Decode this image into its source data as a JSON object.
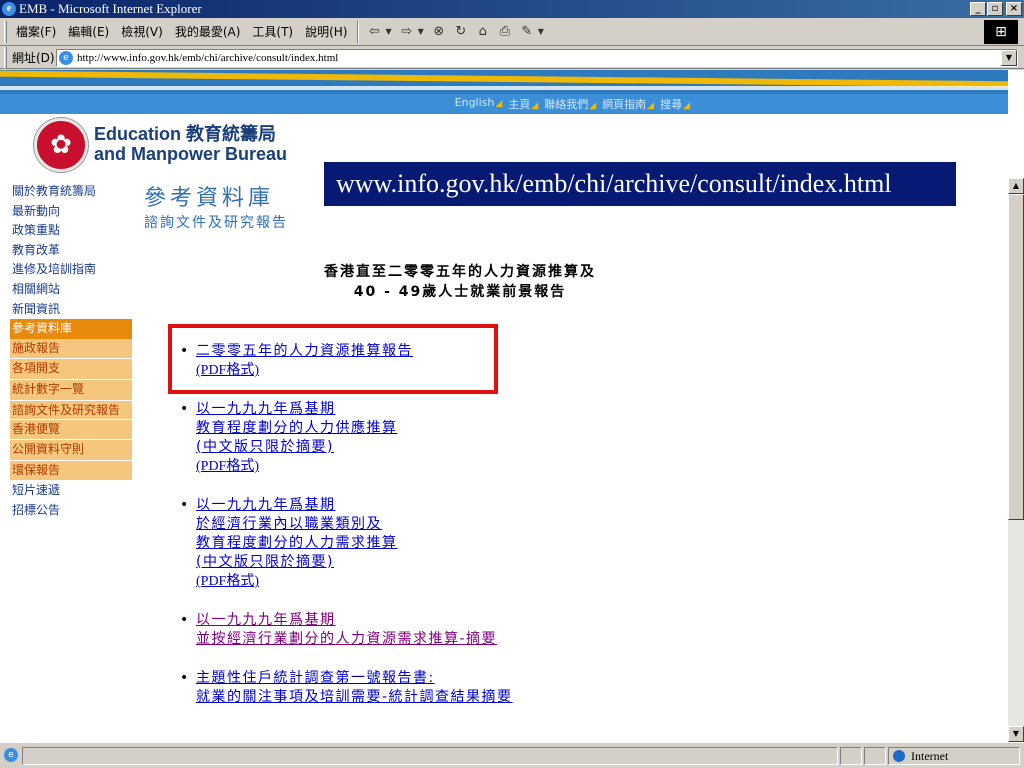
{
  "window": {
    "title": "EMB - Microsoft Internet Explorer"
  },
  "menu": {
    "items": [
      "檔案(F)",
      "編輯(E)",
      "檢視(V)",
      "我的最愛(A)",
      "工具(T)",
      "說明(H)"
    ]
  },
  "toolbar_icons": [
    "back-icon",
    "forward-icon",
    "stop-icon",
    "refresh-icon",
    "home-icon",
    "print-icon",
    "edit-icon"
  ],
  "address": {
    "label": "網址(D)",
    "url": "http://www.info.gov.hk/emb/chi/archive/consult/index.html"
  },
  "topnav": [
    "English",
    "主頁",
    "聯絡我們",
    "網頁指南",
    "搜尋"
  ],
  "org": {
    "line1": "Education 教育統籌局",
    "line2": "and Manpower Bureau"
  },
  "url_overlay": "www.info.gov.hk/emb/chi/archive/consult/index.html",
  "leftnav": [
    "關於教育統籌局",
    "最新動向",
    "政策重點",
    "教育改革",
    "進修及培訓指南",
    "相關網站",
    "新聞資訊",
    "參考資料庫",
    "施政報告",
    "各項開支",
    "統計數字一覽",
    "諮詢文件及研究報告",
    "香港便覽",
    "公開資料守則",
    "環保報告",
    "短片速遞",
    "招標公告"
  ],
  "section": {
    "title": "參考資料庫",
    "subtitle": "諮詢文件及研究報告"
  },
  "heading": {
    "line1": "香港直至二零零五年的人力資源推算及",
    "line2": "40 - 49歲人士就業前景報告"
  },
  "links": [
    {
      "lines": [
        "二零零五年的人力資源推算報告",
        "(PDF格式)"
      ]
    },
    {
      "lines": [
        "以一九九九年爲基期",
        "教育程度劃分的人力供應推算",
        "(中文版只限於摘要)",
        "(PDF格式)"
      ]
    },
    {
      "lines": [
        "以一九九九年爲基期",
        "於經濟行業內以職業類別及",
        "教育程度劃分的人力需求推算",
        "(中文版只限於摘要)",
        "(PDF格式)"
      ]
    },
    {
      "lines": [
        "以一九九九年爲基期",
        "並按經濟行業劃分的人力資源需求推算-摘要"
      ]
    },
    {
      "lines": [
        "主題性住戶統計調查第一號報告書:",
        "就業的關注事項及培訓需要-統計調查結果摘要"
      ]
    }
  ],
  "status": {
    "zone": "Internet"
  }
}
